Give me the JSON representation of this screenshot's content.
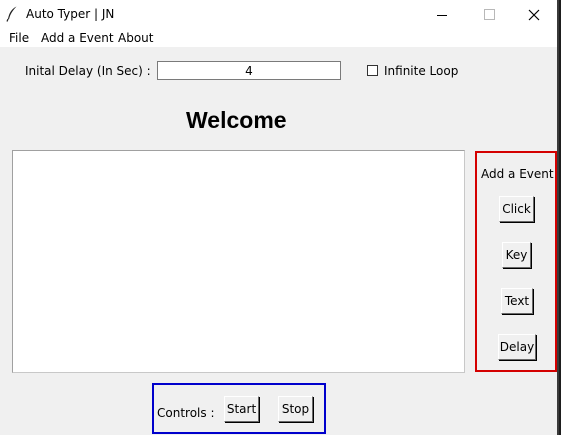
{
  "window": {
    "title": "Auto Typer | JN",
    "close_glyph": "✕"
  },
  "menu": {
    "items": [
      "File",
      "Add a Event",
      "About"
    ]
  },
  "settings": {
    "delay_label": "Inital Delay (In Sec) :",
    "delay_value": "4",
    "loop_label": "Infinite Loop",
    "loop_checked": false
  },
  "main": {
    "heading": "Welcome"
  },
  "event_panel": {
    "label": "Add a Event :",
    "border_color": "#d40000",
    "buttons": [
      "Click",
      "Key",
      "Text",
      "Delay"
    ]
  },
  "controls": {
    "label": "Controls :",
    "border_color": "#0000cc",
    "start_label": "Start",
    "stop_label": "Stop"
  },
  "icons": [
    "feather-icon",
    "minimize-icon",
    "maximize-icon",
    "close-icon",
    "checkbox-icon"
  ]
}
